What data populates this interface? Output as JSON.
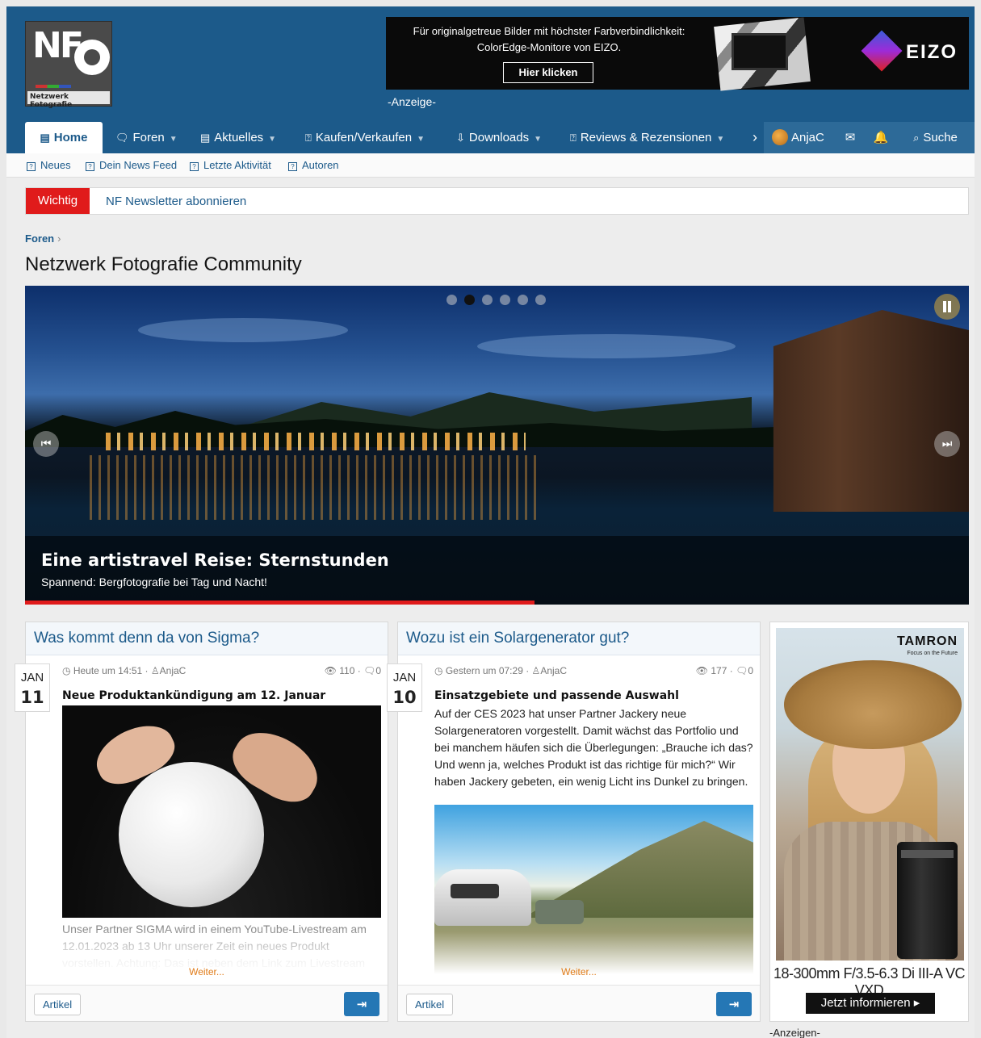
{
  "header": {
    "logo": {
      "mark": "NF",
      "caption": "Netzwerk Fotografie"
    },
    "ad": {
      "text_line1": "Für originalgetreue Bilder mit höchster Farbverbindlichkeit:",
      "text_line2": "ColorEdge-Monitore von EIZO.",
      "button": "Hier klicken",
      "brand": "EIZO",
      "label": "-Anzeige-"
    }
  },
  "nav": {
    "items": [
      {
        "label": "Home",
        "icon": "newspaper-icon"
      },
      {
        "label": "Foren",
        "icon": "chat-icon"
      },
      {
        "label": "Aktuelles",
        "icon": "newspaper-icon"
      },
      {
        "label": "Kaufen/Verkaufen",
        "icon": "question-box-icon"
      },
      {
        "label": "Downloads",
        "icon": "download-icon"
      },
      {
        "label": "Reviews & Rezensionen",
        "icon": "question-box-icon"
      }
    ],
    "user": "AnjaC",
    "search": "Suche"
  },
  "subnav": [
    "Neues",
    "Dein News Feed",
    "Letzte Aktivität",
    "Autoren"
  ],
  "notice": {
    "tag": "Wichtig",
    "link": "NF Newsletter abonnieren"
  },
  "breadcrumb": {
    "item": "Foren",
    "separator": "›"
  },
  "page_title": "Netzwerk Fotografie Community",
  "slider": {
    "title": "Eine artistravel Reise: Sternstunden",
    "subtitle": "Spannend: Bergfotografie bei Tag und Nacht!",
    "slides": 6,
    "active_slide": 2,
    "progress": 0.54
  },
  "articles": [
    {
      "title": "Was kommt denn da von Sigma?",
      "month": "JAN",
      "day": "11",
      "date": "Heute um 14:51",
      "author": "AnjaC",
      "views": "110",
      "replies": "0",
      "subtitle": "Neue Produktankündigung am 12. Januar",
      "body": "Unser Partner SIGMA wird in einem YouTube-Livestream am 12.01.2023 ab 13 Uhr unserer Zeit ein neues Produkt vorstellen. Achtung: Das ist neben dem Link zum Livestream",
      "more": "Weiter...",
      "tag": "Artikel"
    },
    {
      "title": "Wozu ist ein Solargenerator gut?",
      "month": "JAN",
      "day": "10",
      "date": "Gestern um 07:29",
      "author": "AnjaC",
      "views": "177",
      "replies": "0",
      "subtitle": "Einsatzgebiete und passende Auswahl",
      "body": "Auf der CES 2023 hat unser Partner Jackery neue Solargeneratoren vorgestellt. Damit wächst das Portfolio und bei manchem häufen sich die Überlegungen: „Brauche ich das? Und wenn ja, welches Produkt ist das richtige für mich?“ Wir haben Jackery gebeten, ein wenig Licht ins Dunkel zu bringen.",
      "more": "Weiter...",
      "tag": "Artikel"
    }
  ],
  "side_ad": {
    "brand": "TAMRON",
    "tagline": "Focus on the Future",
    "model": "18-300mm F/3.5-6.3 Di III-A VC VXD",
    "cta": "Jetzt informieren ▸",
    "label": "-Anzeigen-"
  },
  "colors": {
    "header": "#1c5a8a",
    "accent": "#e01b1b",
    "link": "#1c5a8a",
    "more": "#e07b18"
  }
}
